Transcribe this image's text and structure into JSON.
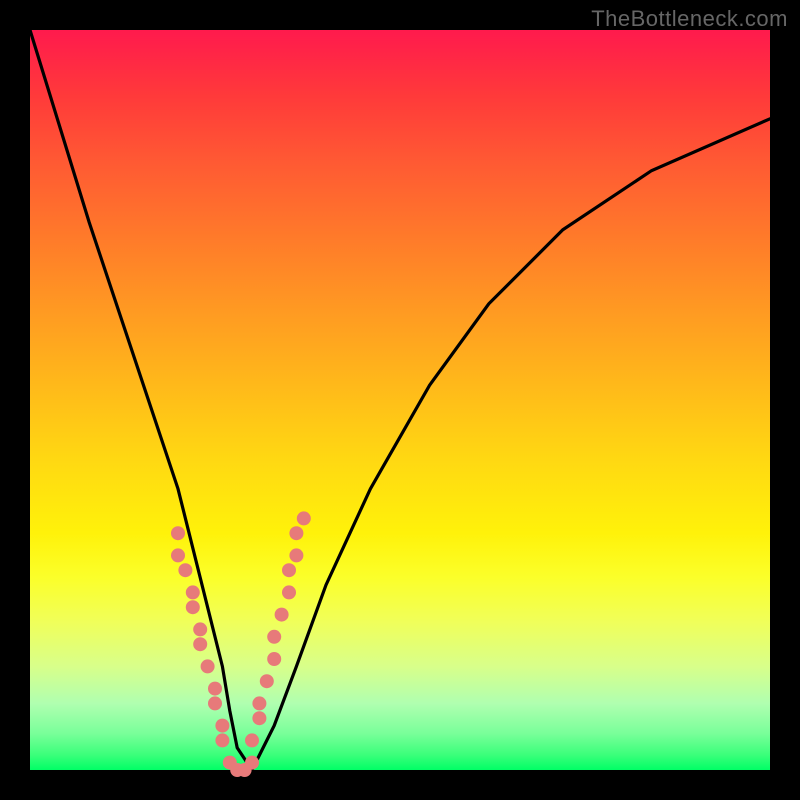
{
  "watermark": "TheBottleneck.com",
  "colors": {
    "frame": "#000000",
    "curve": "#000000",
    "point": "#e77a7a",
    "gradient_top": "#ff1a4d",
    "gradient_bottom": "#00ff66"
  },
  "chart_data": {
    "type": "line",
    "title": "",
    "xlabel": "",
    "ylabel": "",
    "xlim": [
      0,
      100
    ],
    "ylim": [
      0,
      100
    ],
    "annotations": [
      "TheBottleneck.com"
    ],
    "grid": false,
    "legend": false,
    "series": [
      {
        "name": "bottleneck-curve",
        "x": [
          0,
          4,
          8,
          12,
          16,
          20,
          23,
          26,
          27,
          28,
          30,
          33,
          36,
          40,
          46,
          54,
          62,
          72,
          84,
          100
        ],
        "values": [
          100,
          87,
          74,
          62,
          50,
          38,
          26,
          14,
          8,
          3,
          0,
          6,
          14,
          25,
          38,
          52,
          63,
          73,
          81,
          88
        ]
      }
    ],
    "scatter": [
      {
        "name": "hotspots-left",
        "x": [
          20,
          20,
          21,
          22,
          22,
          23,
          23,
          24,
          25,
          25,
          26,
          26
        ],
        "values": [
          32,
          29,
          27,
          24,
          22,
          19,
          17,
          14,
          11,
          9,
          6,
          4
        ]
      },
      {
        "name": "hotspots-right",
        "x": [
          30,
          31,
          31,
          32,
          33,
          33,
          34,
          35,
          35,
          36,
          36,
          37
        ],
        "values": [
          4,
          7,
          9,
          12,
          15,
          18,
          21,
          24,
          27,
          29,
          32,
          34
        ]
      },
      {
        "name": "hotspots-bottom",
        "x": [
          27,
          28,
          29,
          30
        ],
        "values": [
          1,
          0,
          0,
          1
        ]
      }
    ]
  }
}
